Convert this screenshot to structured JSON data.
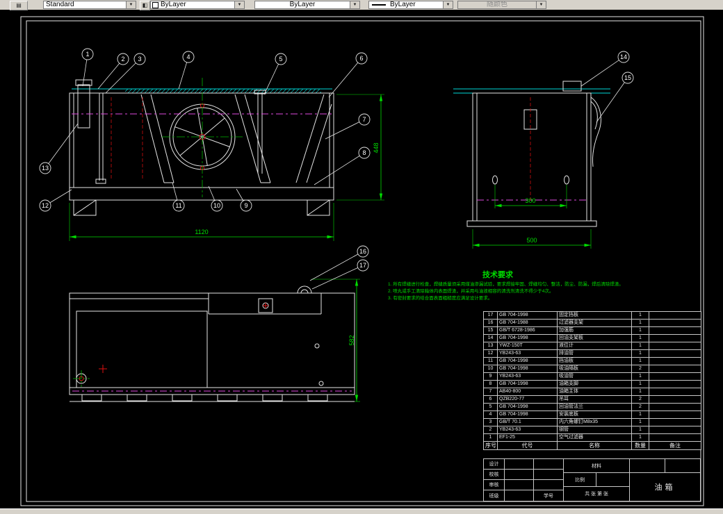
{
  "toolbar": {
    "style_combo": "Standard",
    "color_combo": "ByLayer",
    "linetype_combo": "ByLayer",
    "lineweight_combo": "ByLayer",
    "plotstyle_combo": "随颜色"
  },
  "drawing": {
    "callouts": [
      "1",
      "2",
      "3",
      "4",
      "5",
      "6",
      "7",
      "8",
      "9",
      "10",
      "11",
      "12",
      "13",
      "14",
      "15",
      "16",
      "17"
    ],
    "dims": {
      "front_width": "1120",
      "front_height": "448",
      "side_span": "300",
      "side_width": "500",
      "plan_height": "582"
    },
    "tech": {
      "title": "技术要求",
      "lines": [
        "1. 所有焊缝进行检查，焊缝质量须采用煤油渗漏试验，要求焊接牢固、焊缝均匀、整洁，防尘、防漏，焊后清除焊渣。",
        "2. 喷丸或手工清除箱体内表面焊渣，并采用与油液相容的清洗剂清洗不得少于4次。",
        "3. 有密封要求的结合面表面粗糙度应满足设计要求。"
      ]
    }
  },
  "parts_table": {
    "headers": [
      "序号",
      "代号",
      "名称",
      "数量",
      "备注"
    ],
    "rows": [
      {
        "no": "17",
        "code": "GB 704-1998",
        "name": "固定挡板",
        "qty": "1",
        "note": ""
      },
      {
        "no": "16",
        "code": "GB 704-1988",
        "name": "过滤器支架",
        "qty": "1",
        "note": ""
      },
      {
        "no": "15",
        "code": "GB/T 6728-1986",
        "name": "加强筋",
        "qty": "1",
        "note": ""
      },
      {
        "no": "14",
        "code": "GB 704-1998",
        "name": "回油支架板",
        "qty": "1",
        "note": ""
      },
      {
        "no": "13",
        "code": "YWZ-150T",
        "name": "液位计",
        "qty": "1",
        "note": ""
      },
      {
        "no": "12",
        "code": "YB243-63",
        "name": "排油管",
        "qty": "1",
        "note": ""
      },
      {
        "no": "11",
        "code": "GB 704-1998",
        "name": "挡油板",
        "qty": "1",
        "note": ""
      },
      {
        "no": "10",
        "code": "GB 704-1998",
        "name": "吸油隔板",
        "qty": "2",
        "note": ""
      },
      {
        "no": "9",
        "code": "YB243-63",
        "name": "吸油管",
        "qty": "1",
        "note": ""
      },
      {
        "no": "8",
        "code": "GB 704-1998",
        "name": "油箱支脚",
        "qty": "1",
        "note": ""
      },
      {
        "no": "7",
        "code": "AB40-800",
        "name": "油箱主体",
        "qty": "1",
        "note": ""
      },
      {
        "no": "6",
        "code": "QZB220-77",
        "name": "吊耳",
        "qty": "2",
        "note": ""
      },
      {
        "no": "5",
        "code": "GB 704-1998",
        "name": "回油管法兰",
        "qty": "2",
        "note": ""
      },
      {
        "no": "4",
        "code": "GB 704-1998",
        "name": "安装底板",
        "qty": "1",
        "note": ""
      },
      {
        "no": "3",
        "code": "GB/T 70.1",
        "name": "内六角螺钉M8x35",
        "qty": "1",
        "note": ""
      },
      {
        "no": "2",
        "code": "YB243-63",
        "name": "钢管",
        "qty": "1",
        "note": ""
      },
      {
        "no": "1",
        "code": "EF1-25",
        "name": "空气过滤器",
        "qty": "1",
        "note": ""
      }
    ]
  },
  "title_block": {
    "row_labels": [
      "设计",
      "校核",
      "审核",
      "班级"
    ],
    "student_label": "学号",
    "material_label": "材料",
    "scale_label": "比例",
    "sheet_label": "共 张 第 张",
    "drawing_title": "油箱"
  }
}
